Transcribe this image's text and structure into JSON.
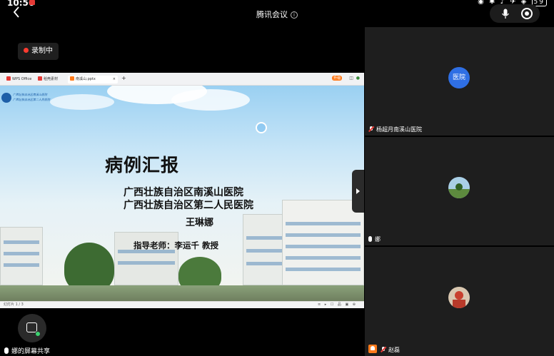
{
  "status_bar": {
    "time": "10:56",
    "battery": "59"
  },
  "header": {
    "title": "腾讯会议",
    "back_icon": "chevron-left-icon"
  },
  "recording_badge": {
    "label": "录制中"
  },
  "shared_screen": {
    "tabs": [
      {
        "label": "WPS Office",
        "icon_color": "#e53935"
      },
      {
        "label": "稻壳素材",
        "icon_color": "#e53935"
      },
      {
        "label": "南溪山.pptx",
        "icon_color": "#ff7a1a"
      }
    ],
    "upgrade_label": "升级",
    "slide": {
      "title": "病例汇报",
      "hospital_1": "广西壮族自治区南溪山医院",
      "hospital_2": "广西壮族自治区第二人民医院",
      "presenter": "王琳娜",
      "advisor": "指导老师：李运千 教授"
    },
    "status_left": "幻灯片 1 / 3",
    "status_right": "≡ ▸ ☐ 品 ▣ ⊕"
  },
  "share_label": "娜的屏幕共享",
  "participants": [
    {
      "name": "杨超月南溪山医院",
      "avatar_text": "医院",
      "mic": "muted"
    },
    {
      "name": "娜",
      "mic": "on"
    },
    {
      "name": "赵磊",
      "mic": "muted",
      "sharing": true
    }
  ]
}
